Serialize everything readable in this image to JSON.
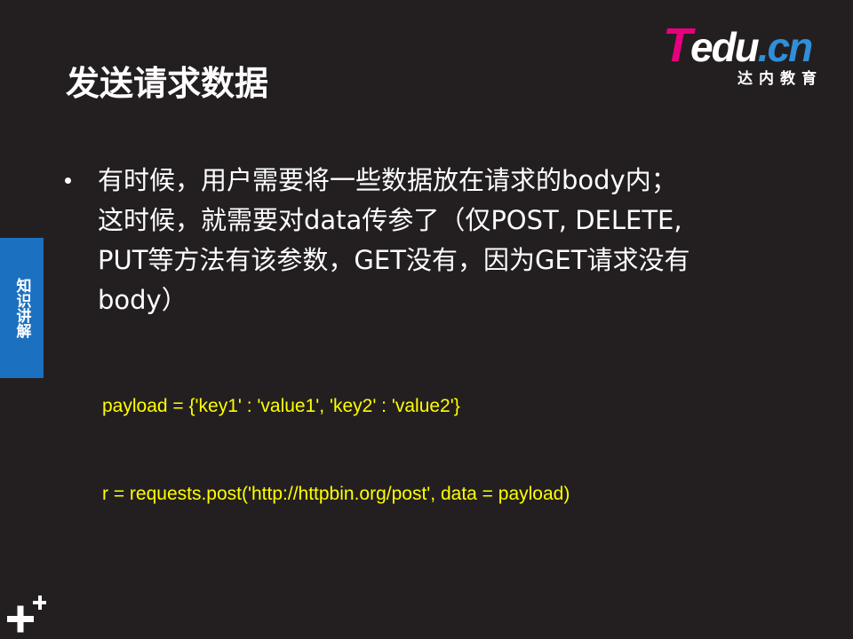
{
  "logo": {
    "letter_t": "T",
    "letters_edu": "edu",
    "letters_cn": ".cn",
    "subtitle": "达内教育",
    "colors": {
      "magenta": "#e6007e",
      "blue": "#2f8fd8",
      "white": "#ffffff"
    }
  },
  "slide": {
    "title": "发送请求数据",
    "side_tab": "知识讲解",
    "bullet_lines": [
      "有时候，用户需要将一些数据放在请求的body内；",
      "这时候，就需要对data传参了（仅POST, DELETE,",
      "PUT等方法有该参数，GET没有，因为GET请求没有",
      "body）"
    ],
    "code_lines": [
      "payload = {'key1' : 'value1', 'key2' : 'value2'}",
      "r = requests.post('http://httpbin.org/post', data = payload)"
    ]
  },
  "icons": {
    "bullet": "bullet-dot-icon",
    "corner": "plus-icon"
  },
  "colors": {
    "background": "#231f20",
    "text": "#ffffff",
    "code": "#ffff00",
    "side_tab": "#1b70c0"
  }
}
